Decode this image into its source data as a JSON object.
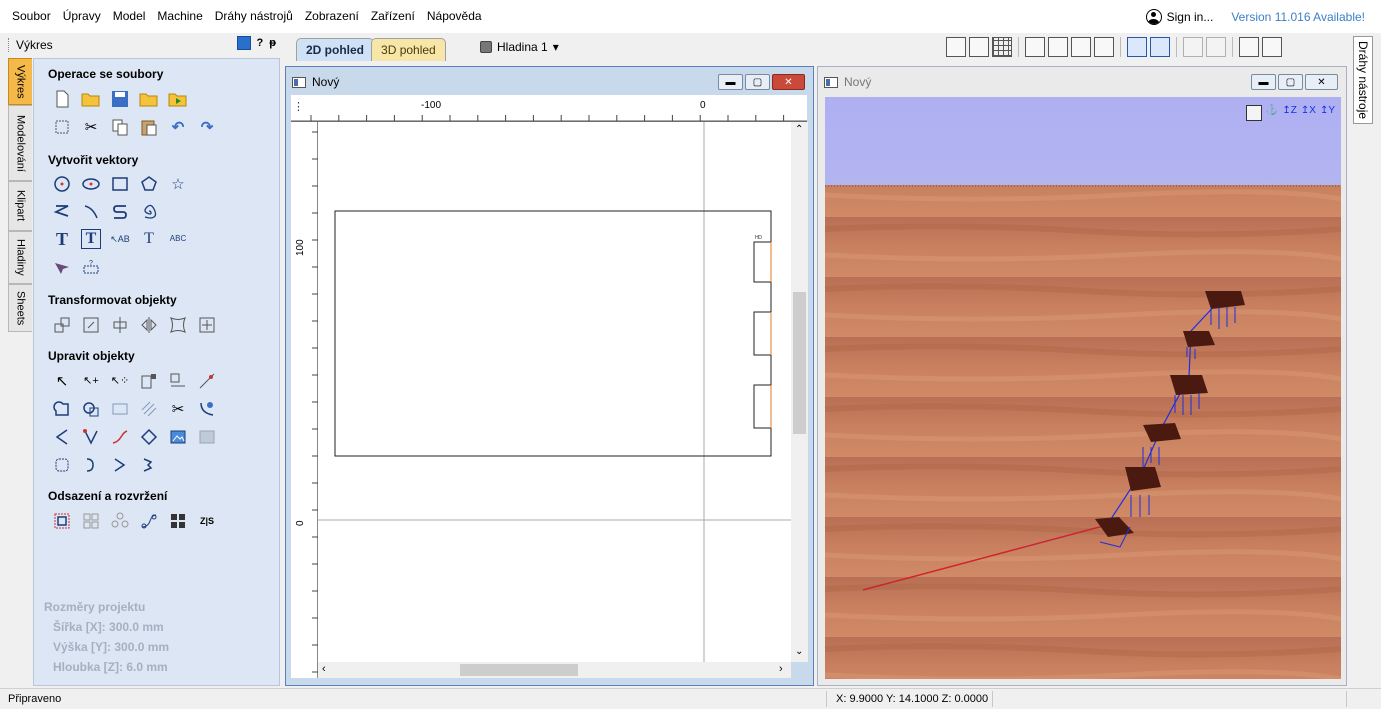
{
  "menu": [
    "Soubor",
    "Úpravy",
    "Model",
    "Machine",
    "Dráhy nástrojů",
    "Zobrazení",
    "Zařízení",
    "Nápověda"
  ],
  "account": {
    "signin": "Sign in...",
    "version": "Version 11.016 Available!"
  },
  "left_panel": {
    "title": "Výkres",
    "help": "?",
    "pin": "ᵽ",
    "tabs": [
      "Výkres",
      "Modelování",
      "Klipart",
      "Hladiny",
      "Sheets"
    ],
    "sections": {
      "files": "Operace se soubory",
      "vectors": "Vytvořit vektory",
      "transform": "Transformovat objekty",
      "edit": "Upravit objekty",
      "offset": "Odsazení a rozvržení"
    },
    "project": {
      "title": "Rozměry projektu",
      "width": "Šířka  [X]: 300.0 mm",
      "height": "Výška  [Y]: 300.0 mm",
      "depth": "Hloubka [Z]: 6.0 mm"
    }
  },
  "view_tabs": {
    "tab_2d": "2D pohled",
    "tab_3d": "3D pohled"
  },
  "layer": {
    "name": "Hladina 1"
  },
  "window_2d": {
    "title": "Nový",
    "ruler_top": [
      "-100",
      "0"
    ],
    "ruler_left": [
      "100",
      "0"
    ]
  },
  "window_3d": {
    "title": "Nový"
  },
  "right_tab": "Dráhy nástroje",
  "status": {
    "text": "Připraveno",
    "coords": "X: 9.9000 Y: 14.1000 Z: 0.0000"
  },
  "colors": {
    "accent_blue": "#3c7fc6",
    "panel_bg": "#dce6f4",
    "active_tab": "#f5b94a",
    "toolpath_red": "#e0201c",
    "toolpath_blue": "#1c2fe0"
  }
}
